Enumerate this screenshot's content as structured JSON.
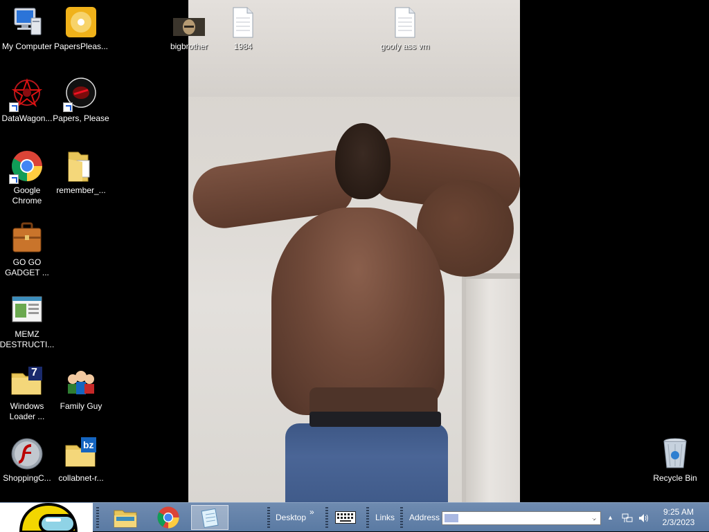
{
  "desktop": {
    "icons": [
      {
        "label": "My Computer",
        "icon": "computer-icon"
      },
      {
        "label": "PapersPleas...",
        "icon": "disc-icon"
      },
      {
        "label": "DataWagon...",
        "icon": "datawagon-icon"
      },
      {
        "label": "Papers, Please",
        "icon": "papers-please-icon"
      },
      {
        "label": "Google Chrome",
        "icon": "chrome-icon"
      },
      {
        "label": "remember_...",
        "icon": "folder-icon"
      },
      {
        "label": "GO GO GADGET ...",
        "icon": "briefcase-icon"
      },
      {
        "label": "MEMZ DESTRUCTI...",
        "icon": "window-icon"
      },
      {
        "label": "Windows Loader ...",
        "icon": "folder-7-icon"
      },
      {
        "label": "Family Guy",
        "icon": "family-guy-icon"
      },
      {
        "label": "ShoppingC...",
        "icon": "flash-icon"
      },
      {
        "label": "collabnet-r...",
        "icon": "folder-bz-icon"
      },
      {
        "label": "bigbrother",
        "icon": "image-thumbnail-icon"
      },
      {
        "label": "1984",
        "icon": "text-file-icon"
      },
      {
        "label": "goofy ass vm",
        "icon": "text-file-icon"
      },
      {
        "label": "Recycle Bin",
        "icon": "recycle-bin-icon"
      }
    ],
    "folder_badges": {
      "windows_loader": "7",
      "collabnet": "bz"
    },
    "wallpaper": "photo"
  },
  "taskbar": {
    "pinned": [
      {
        "name": "explorer",
        "icon": "file-explorer-icon"
      },
      {
        "name": "chrome",
        "icon": "chrome-icon"
      },
      {
        "name": "notepad",
        "icon": "notepad-icon"
      }
    ],
    "desktop_label": "Desktop",
    "overflow_chevron": "»",
    "links_label": "Links",
    "address_label": "Address",
    "address_value": "",
    "clock_time": "9:25 AM",
    "clock_date": "2/3/2023"
  },
  "colors": {
    "taskbar": "#5a7aa3",
    "desktop_background": "#000000",
    "start_button_yellow": "#f2d600"
  }
}
